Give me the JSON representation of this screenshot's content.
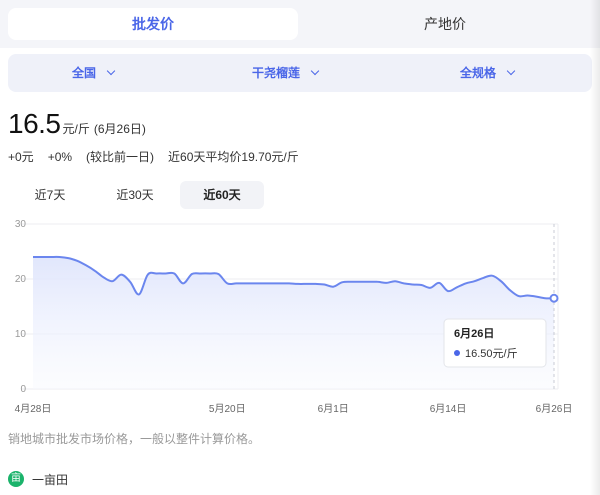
{
  "tabs": [
    {
      "label": "批发价",
      "active": true
    },
    {
      "label": "产地价",
      "active": false
    }
  ],
  "filters": [
    {
      "label": "全国"
    },
    {
      "label": "干尧榴莲"
    },
    {
      "label": "全规格"
    }
  ],
  "price": {
    "value": "16.5",
    "unit": "元/斤",
    "date": "(6月26日)"
  },
  "change": {
    "abs": "+0元",
    "pct": "+0%",
    "compare": "(较比前一日)",
    "avg": "近60天平均价19.70元/斤"
  },
  "range_tabs": [
    {
      "label": "近7天",
      "active": false
    },
    {
      "label": "近30天",
      "active": false
    },
    {
      "label": "近60天",
      "active": true
    }
  ],
  "tooltip": {
    "date": "6月26日",
    "value": "16.50元/斤"
  },
  "note": "销地城市批发市场价格，一般以整件计算价格。",
  "footer": {
    "logo_text": "亩",
    "label": "一亩田"
  },
  "colors": {
    "accent": "#4a66e8",
    "line": "#6b86ee",
    "area": "#eef1fd"
  },
  "chart_data": {
    "type": "area",
    "title": "",
    "xlabel": "",
    "ylabel": "",
    "ylim": [
      0,
      30
    ],
    "yticks": [
      0,
      10,
      20,
      30
    ],
    "grid": true,
    "x_ticks": [
      {
        "label": "4月28日",
        "day": 0
      },
      {
        "label": "5月20日",
        "day": 22
      },
      {
        "label": "6月1日",
        "day": 34
      },
      {
        "label": "6月14日",
        "day": 47
      },
      {
        "label": "6月26日",
        "day": 59
      }
    ],
    "series": [
      {
        "day": [
          0,
          1,
          2,
          3,
          4,
          5,
          6,
          7,
          8,
          9,
          10,
          11,
          12,
          13,
          14,
          15,
          16,
          17,
          18,
          19,
          20,
          21,
          22,
          23,
          24,
          25,
          26,
          27,
          28,
          29,
          30,
          31,
          32,
          33,
          34,
          35,
          36,
          37,
          38,
          39,
          40,
          41,
          42,
          43,
          44,
          45,
          46,
          47,
          48,
          49,
          50,
          51,
          52,
          53,
          54,
          55,
          56,
          57,
          58,
          59
        ],
        "values": [
          24.0,
          24.0,
          24.0,
          24.0,
          23.8,
          23.3,
          22.5,
          21.5,
          20.3,
          19.6,
          20.8,
          19.5,
          17.2,
          20.8,
          21.0,
          21.0,
          21.0,
          19.2,
          20.9,
          21.0,
          21.0,
          20.9,
          19.2,
          19.2,
          19.2,
          19.2,
          19.2,
          19.2,
          19.2,
          19.2,
          19.1,
          19.1,
          19.1,
          19.0,
          18.6,
          19.4,
          19.5,
          19.5,
          19.5,
          19.5,
          19.3,
          19.6,
          19.2,
          19.0,
          18.9,
          18.4,
          19.3,
          17.8,
          18.5,
          19.2,
          19.6,
          20.2,
          20.6,
          19.6,
          18.0,
          16.9,
          17.0,
          16.8,
          16.5,
          16.5
        ]
      }
    ]
  }
}
